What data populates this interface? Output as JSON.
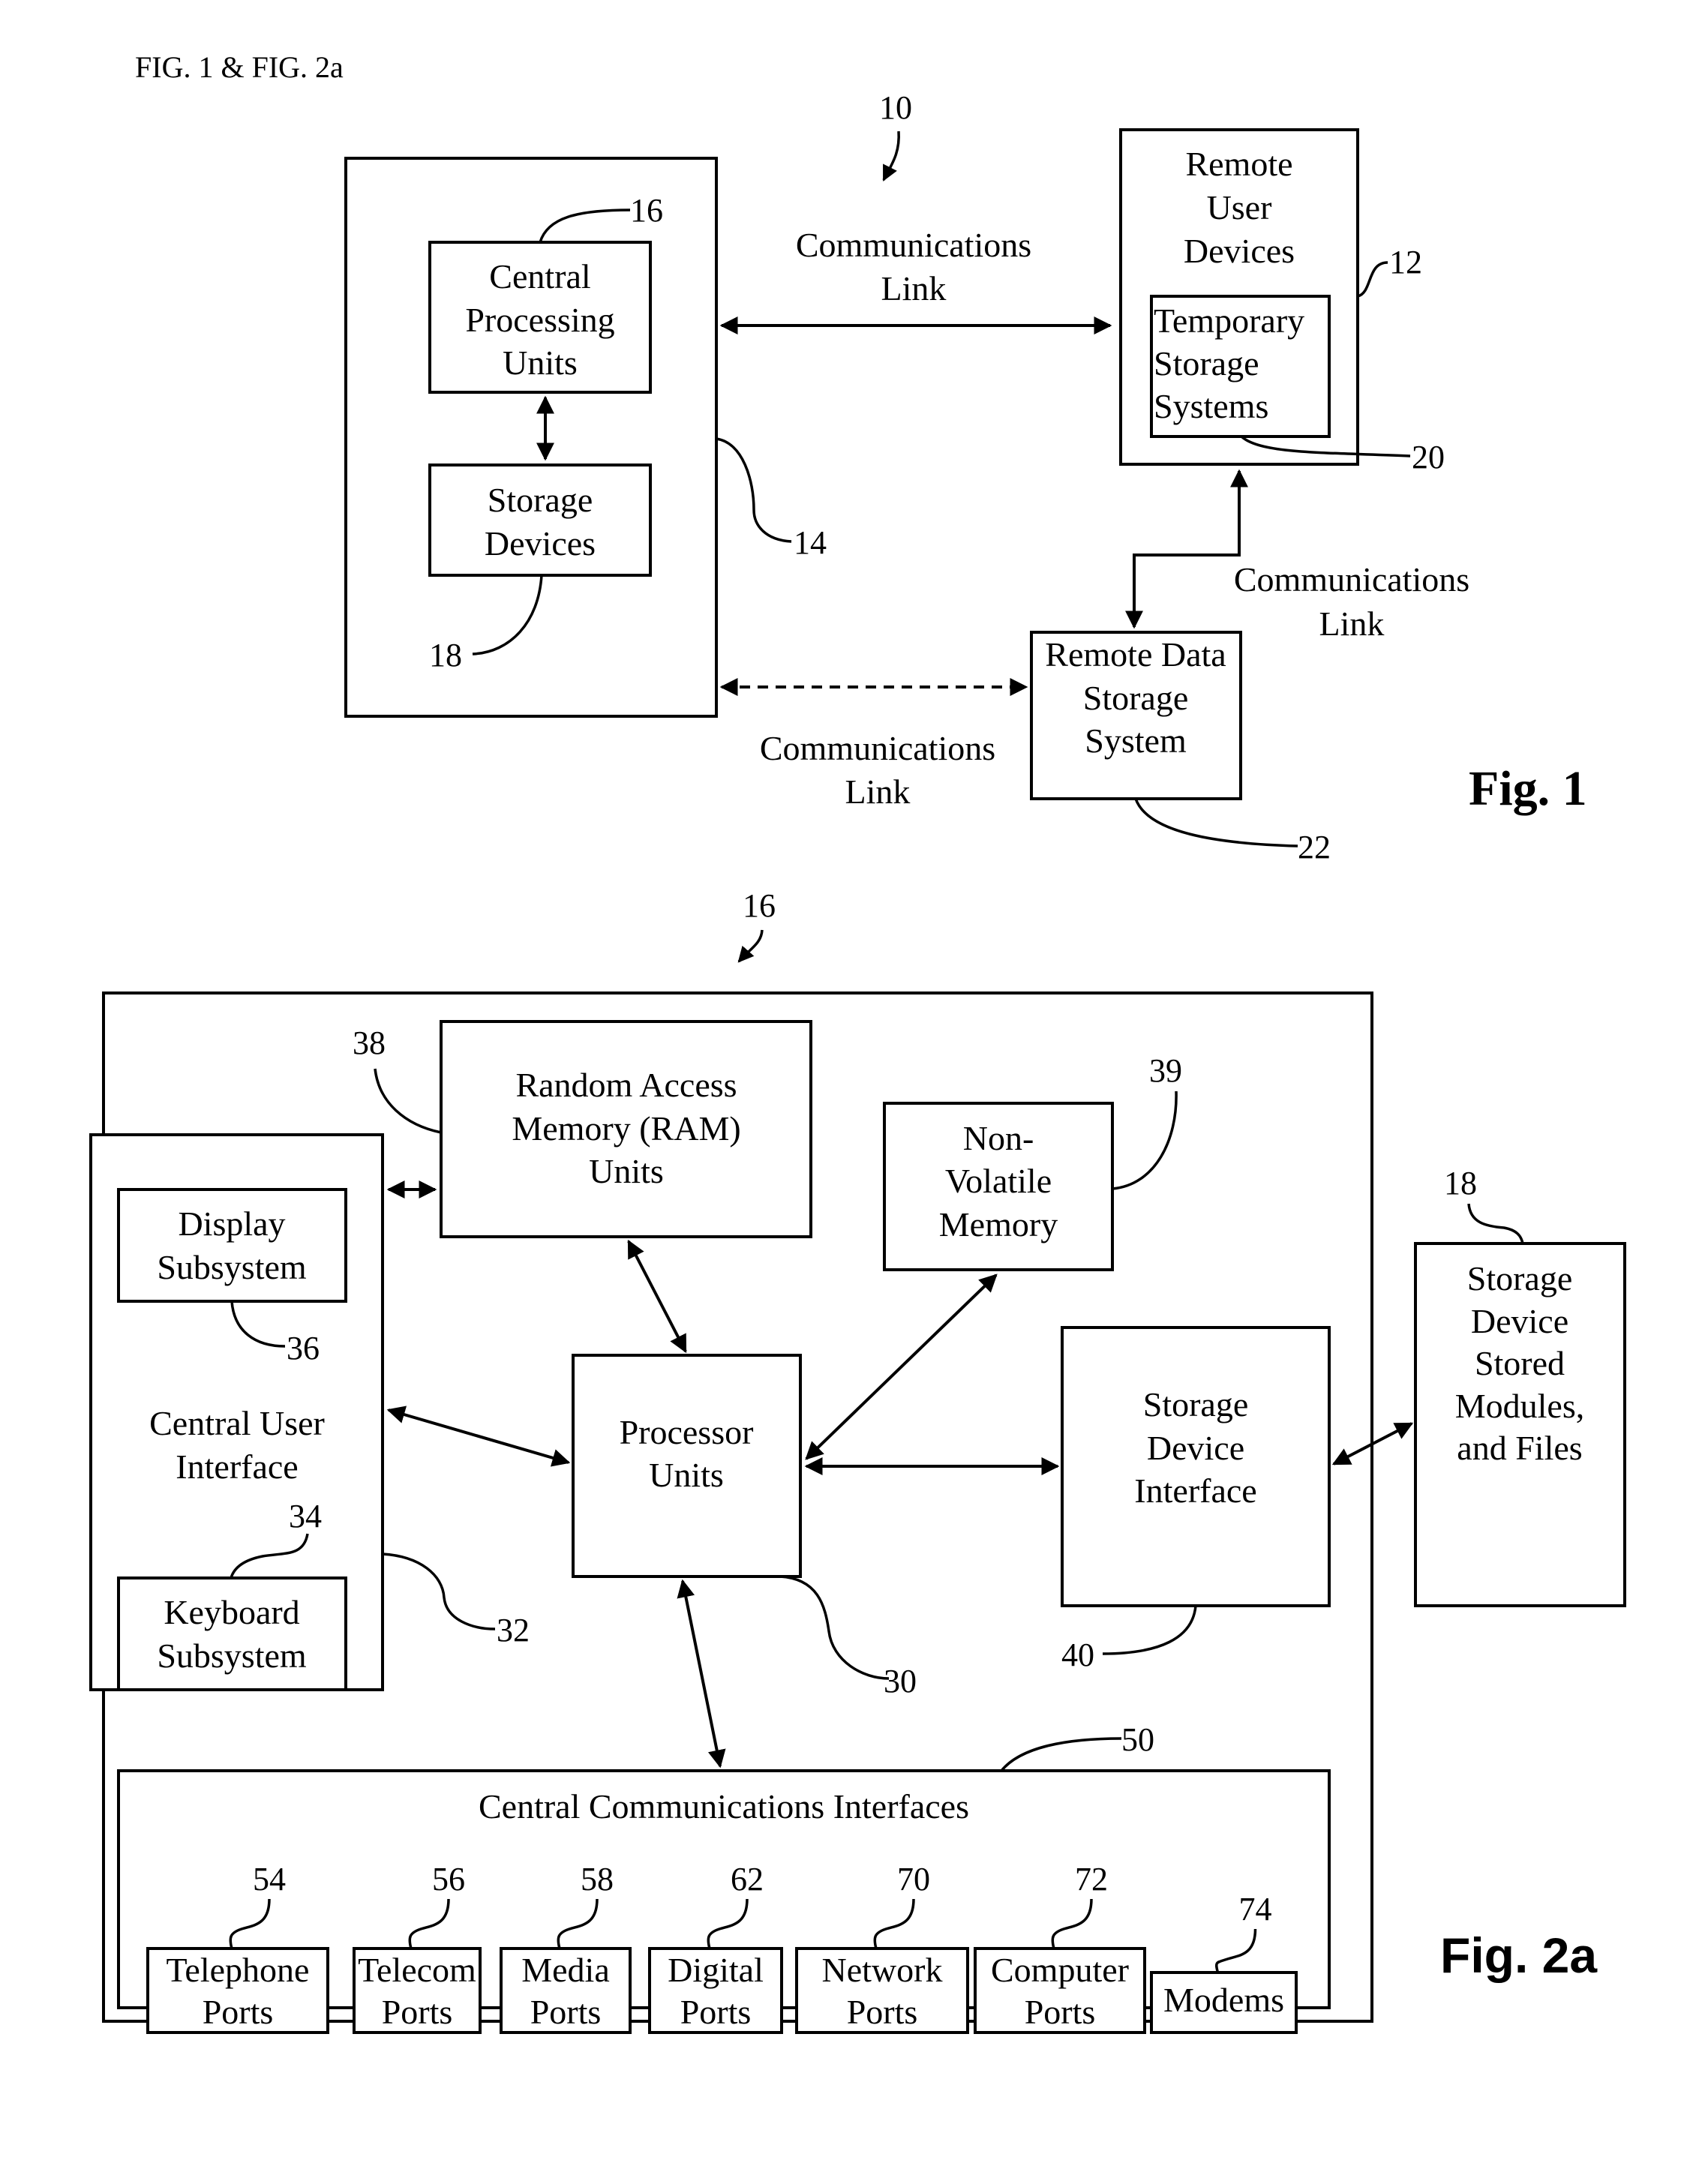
{
  "header": "FIG. 1 & FIG. 2a",
  "fig1": {
    "caption": "Fig. 1",
    "system_ref": "10",
    "host_box_ref": "14",
    "cpu": {
      "lines": [
        "Central",
        "Processing",
        "Units"
      ],
      "ref": "16"
    },
    "storage_devices": {
      "lines": [
        "Storage",
        "Devices"
      ],
      "ref": "18"
    },
    "remote_user_devices": {
      "lines": [
        "Remote",
        "User",
        "Devices"
      ],
      "ref": "12"
    },
    "temporary_storage": {
      "lines": [
        "Temporary",
        "Storage",
        "Systems"
      ],
      "ref": "20"
    },
    "remote_data_storage": {
      "lines": [
        "Remote Data",
        "Storage",
        "System"
      ],
      "ref": "22"
    },
    "links": [
      {
        "lines": [
          "Communications",
          "Link"
        ],
        "style": "solid"
      },
      {
        "lines": [
          "Communications",
          "Link"
        ],
        "style": "solid"
      },
      {
        "lines": [
          "Communications",
          "Link"
        ],
        "style": "dashed"
      }
    ]
  },
  "fig2a": {
    "caption": "Fig. 2a",
    "system_ref": "16",
    "central_user_interface": {
      "lines": [
        "Central User",
        "Interface"
      ],
      "ref": "32"
    },
    "display_subsystem": {
      "lines": [
        "Display",
        "Subsystem"
      ],
      "ref": "36"
    },
    "keyboard_subsystem": {
      "lines": [
        "Keyboard",
        "Subsystem"
      ],
      "ref": "34"
    },
    "ram": {
      "lines": [
        "Random Access",
        "Memory (RAM)",
        "Units"
      ],
      "ref": "38"
    },
    "non_volatile_memory": {
      "lines": [
        "Non-",
        "Volatile",
        "Memory"
      ],
      "ref": "39"
    },
    "processor": {
      "lines": [
        "Processor",
        "Units"
      ],
      "ref": "30"
    },
    "storage_device_interface": {
      "lines": [
        "Storage",
        "Device",
        "Interface"
      ],
      "ref": "40"
    },
    "external_storage": {
      "lines": [
        "Storage",
        "Device",
        "Stored",
        "Modules,",
        "and Files"
      ],
      "ref": "18"
    },
    "communications_interfaces": {
      "title": "Central Communications Interfaces",
      "ref": "50"
    },
    "ports": [
      {
        "lines": [
          "Telephone",
          "Ports"
        ],
        "ref": "54"
      },
      {
        "lines": [
          "Telecom",
          "Ports"
        ],
        "ref": "56"
      },
      {
        "lines": [
          "Media",
          "Ports"
        ],
        "ref": "58"
      },
      {
        "lines": [
          "Digital",
          "Ports"
        ],
        "ref": "62"
      },
      {
        "lines": [
          "Network",
          "Ports"
        ],
        "ref": "70"
      },
      {
        "lines": [
          "Computer",
          "Ports"
        ],
        "ref": "72"
      },
      {
        "lines": [
          "Modems"
        ],
        "ref": "74"
      }
    ]
  }
}
